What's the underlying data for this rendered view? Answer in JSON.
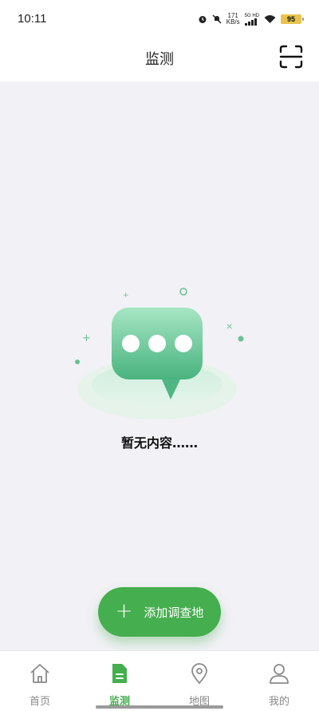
{
  "status_bar": {
    "time": "10:11",
    "net_speed_value": "171",
    "net_speed_unit": "KB/s",
    "network_type": "5G HD",
    "battery": "95"
  },
  "header": {
    "title": "监测"
  },
  "empty_state": {
    "message": "暂无内容……"
  },
  "fab": {
    "icon": "plus-icon",
    "label": "添加调查地"
  },
  "tabs": [
    {
      "label": "首页",
      "icon": "home-icon",
      "active": false
    },
    {
      "label": "监测",
      "icon": "document-icon",
      "active": true
    },
    {
      "label": "地图",
      "icon": "location-pin-icon",
      "active": false
    },
    {
      "label": "我的",
      "icon": "person-icon",
      "active": false
    }
  ],
  "colors": {
    "accent": "#45AE4E",
    "background": "#F2F1F6",
    "inactive": "#888888"
  }
}
